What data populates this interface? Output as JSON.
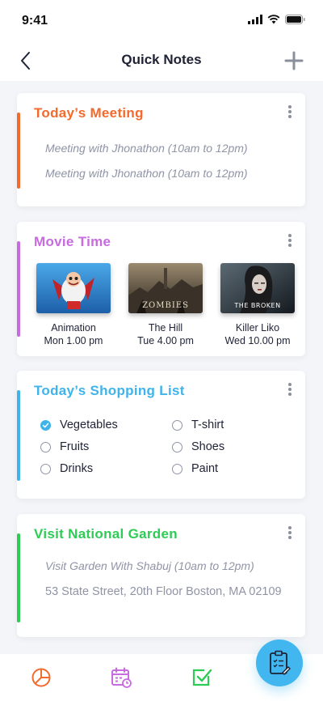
{
  "status_bar": {
    "time": "9:41"
  },
  "nav": {
    "title": "Quick Notes"
  },
  "meeting_card": {
    "title": "Today’s Meeting",
    "accent": "#f26a2e",
    "lines": [
      "Meeting with Jhonathon (10am to 12pm)",
      "Meeting with Jhonathon (10am to 12pm)"
    ]
  },
  "movie_card": {
    "title": "Movie Time",
    "accent": "#c86ae0",
    "movies": [
      {
        "name": "Animation",
        "time": "Mon 1.00 pm",
        "poster_text": ""
      },
      {
        "name": "The Hill",
        "time": "Tue 4.00 pm",
        "poster_text": "ZOMBIES"
      },
      {
        "name": "Killer Liko",
        "time": "Wed 10.00 pm",
        "poster_text": "THE BROKEN"
      }
    ]
  },
  "shopping_card": {
    "title": "Today’s Shopping List",
    "accent": "#3fb3ea",
    "items": [
      {
        "label": "Vegetables",
        "checked": true
      },
      {
        "label": "Fruits",
        "checked": false
      },
      {
        "label": "Drinks",
        "checked": false
      },
      {
        "label": "T-shirt",
        "checked": false
      },
      {
        "label": "Shoes",
        "checked": false
      },
      {
        "label": "Paint",
        "checked": false
      }
    ]
  },
  "garden_card": {
    "title": "Visit National Garden",
    "accent": "#2ecc55",
    "line": "Visit Garden With Shabuj (10am to 12pm)",
    "address": "53 State Street, 20th Floor Boston, MA 02109"
  },
  "tab_bar": {
    "icons": [
      "pie-chart-icon",
      "calendar-icon",
      "checkbox-icon"
    ],
    "fab_icon": "clipboard-icon"
  }
}
